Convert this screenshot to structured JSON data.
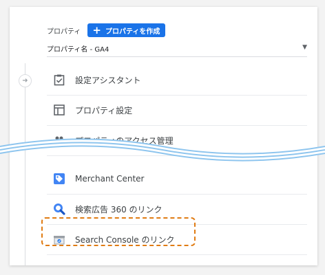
{
  "property": {
    "label": "プロパティ",
    "create_button": "プロパティを作成",
    "create_icon": "plus-icon",
    "selected_property": "プロパティ名 - GA4",
    "dropdown_icon": "caret-down-icon"
  },
  "menu": [
    {
      "label": "設定アシスタント",
      "icon": "clipboard-check-icon"
    },
    {
      "label": "プロパティ設定",
      "icon": "layout-icon"
    },
    {
      "label": "プロパティのアクセス管理",
      "icon": "people-icon"
    },
    {
      "label": "Merchant Center",
      "icon": "merchant-center-icon"
    },
    {
      "label": "検索広告 360 のリンク",
      "icon": "search-ads-360-icon"
    },
    {
      "label": "Search Console のリンク",
      "icon": "search-console-icon"
    }
  ],
  "colors": {
    "accent": "#1a73e8",
    "highlight": "#e07b12",
    "wave": "#8ec5ee"
  }
}
